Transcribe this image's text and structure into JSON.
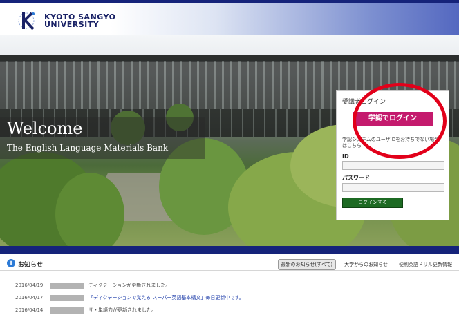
{
  "header": {
    "logo_line1": "KYOTO SANGYO",
    "logo_line2": "UNIVERSITY"
  },
  "hero": {
    "welcome": "Welcome",
    "subtitle": "The English Language Materials Bank"
  },
  "login": {
    "title": "受講者ログイン",
    "sso_button": "学認でログイン",
    "note": "学認システムのユーザIDをお持ちでない場合はこちら",
    "id_label": "ID",
    "password_label": "パスワード",
    "login_button": "ログインする"
  },
  "news": {
    "title": "お知らせ",
    "tabs": [
      {
        "label": "最新のお知らせ(すべて)",
        "active": true
      },
      {
        "label": "大学からのお知らせ",
        "active": false
      },
      {
        "label": "便利英語ドリル更新情報",
        "active": false
      }
    ],
    "items": [
      {
        "date": "2016/04/19",
        "text": "ディクテーションが更新されました。",
        "link": false
      },
      {
        "date": "2016/04/17",
        "text": "「ディクテーションで覚える スーパー英語基本構文」毎日更新中です。",
        "link": true
      },
      {
        "date": "2016/04/14",
        "text": "ザ・単語力が更新されました。",
        "link": false
      }
    ]
  },
  "colors": {
    "brand_navy": "#15237a",
    "sso_button": "#c41a6d",
    "login_button": "#1d6a23",
    "highlight_circle": "#e2001a"
  }
}
